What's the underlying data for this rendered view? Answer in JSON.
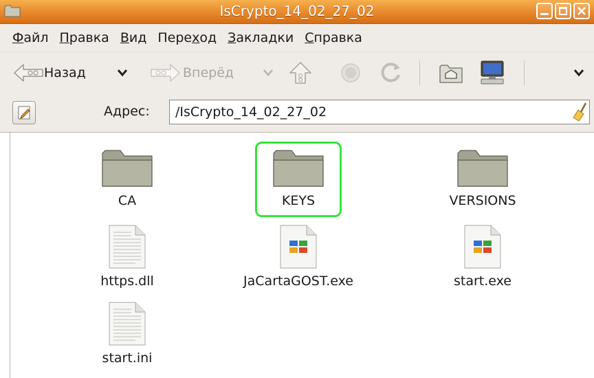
{
  "window": {
    "title": "IsCrypto_14_02_27_02"
  },
  "menubar": {
    "items": [
      {
        "pre": "",
        "ul": "Ф",
        "post": "айл"
      },
      {
        "pre": "",
        "ul": "П",
        "post": "равка"
      },
      {
        "pre": "",
        "ul": "В",
        "post": "ид"
      },
      {
        "pre": "Пере",
        "ul": "х",
        "post": "од"
      },
      {
        "pre": "",
        "ul": "З",
        "post": "акладки"
      },
      {
        "pre": "",
        "ul": "С",
        "post": "правка"
      }
    ]
  },
  "toolbar": {
    "back_label": "Назад",
    "forward_label": "Вперёд"
  },
  "address": {
    "label": "Адрес:",
    "value": "/IsCrypto_14_02_27_02"
  },
  "files": [
    {
      "name": "CA",
      "type": "folder"
    },
    {
      "name": "KEYS",
      "type": "folder",
      "highlighted": true
    },
    {
      "name": "VERSIONS",
      "type": "folder"
    },
    {
      "name": "https.dll",
      "type": "text"
    },
    {
      "name": "JaCartaGOST.exe",
      "type": "exe"
    },
    {
      "name": "start.exe",
      "type": "exe"
    },
    {
      "name": "start.ini",
      "type": "text"
    }
  ],
  "colors": {
    "titlebar": "#e7872b",
    "highlight": "#36e33a",
    "folder": "#a3a391"
  }
}
